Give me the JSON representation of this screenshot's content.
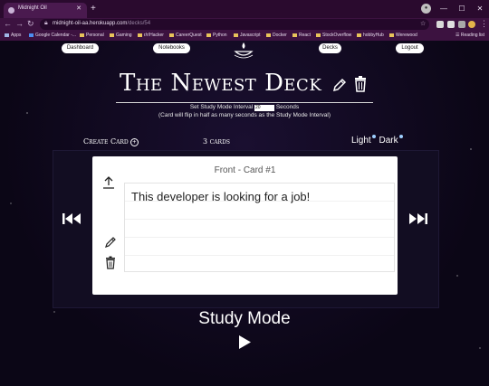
{
  "browser": {
    "tab_title": "Midnight Oil",
    "url_host": "midnight-oil-aa.herokuapp.com",
    "url_path": "/decks/54",
    "bookmarks": [
      "Apps",
      "Google Calendar -...",
      "Personal",
      "Gaming",
      "r/r/Hacker",
      "CareerQuest",
      "Python",
      "Javascript",
      "Docker",
      "React",
      "StockOverflow",
      "hobbyHub",
      "Werewood"
    ],
    "reading_list": "Reading list"
  },
  "nav": {
    "dashboard": "Dashboard",
    "notebooks": "Notebooks",
    "decks": "Decks",
    "logout": "Logout"
  },
  "deck": {
    "title": "The Newest Deck",
    "interval_label": "Set Study Mode Interval",
    "interval_value": "20",
    "interval_unit": "Seconds",
    "interval_note": "(Card will flip in half as many seconds as the Study Mode Interval)",
    "create_card": "Create Card",
    "card_count": "3 cards",
    "theme_light": "Light",
    "theme_dark": "Dark"
  },
  "card": {
    "header": "Front - Card #1",
    "text": "This developer is looking for a job!"
  },
  "study": {
    "title": "Study Mode"
  },
  "colors": {
    "tab_bar": "#2a0a2e",
    "toolbar": "#3c1240",
    "page_bg": "#0b0616",
    "card_bg": "#ffffff"
  }
}
